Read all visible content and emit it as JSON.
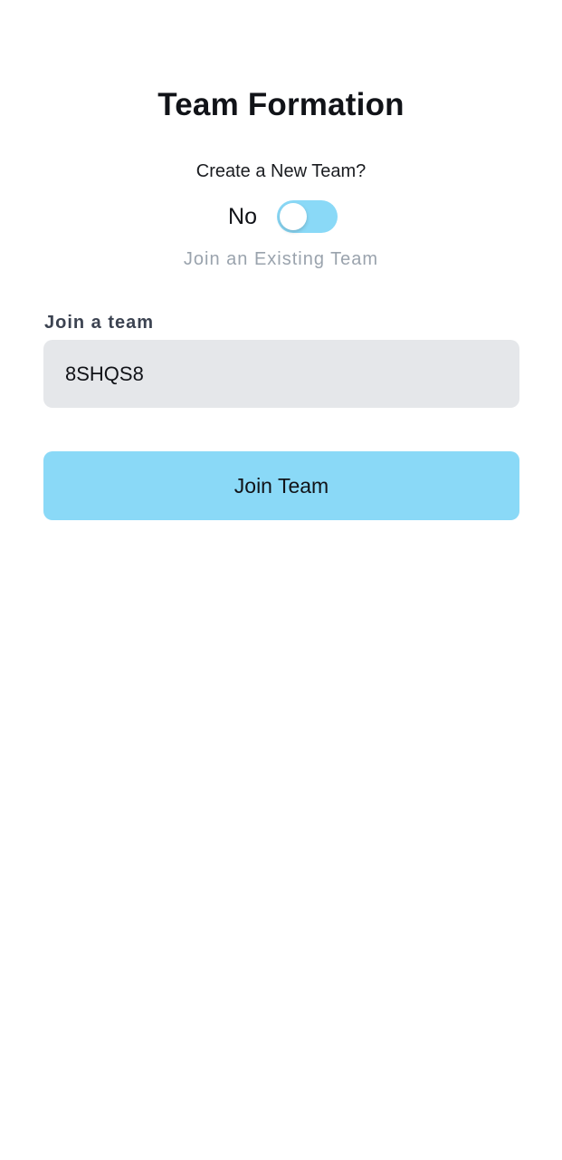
{
  "page": {
    "title": "Team Formation"
  },
  "mode": {
    "question": "Create a New Team?",
    "toggle_state_label": "No",
    "toggle_on": false,
    "caption": "Join an Existing Team"
  },
  "join_form": {
    "label": "Join a team",
    "team_code_value": "8SHQS8",
    "submit_label": "Join Team"
  },
  "colors": {
    "accent": "#8ad9f7",
    "input_background": "#e5e7ea",
    "caption_text": "#9aa3ad",
    "label_text": "#3c4351"
  }
}
